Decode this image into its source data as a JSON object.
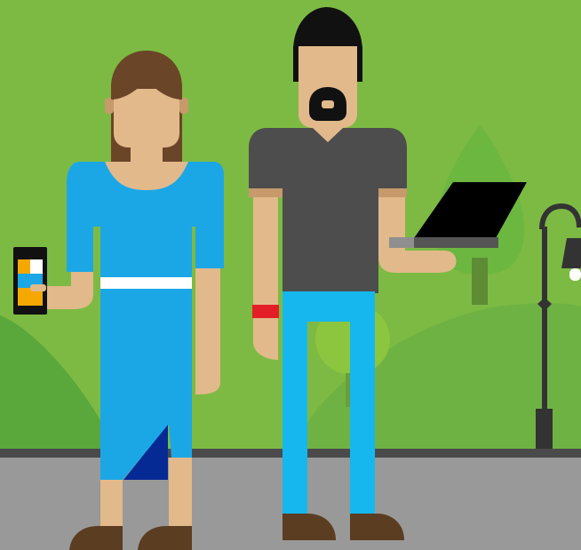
{
  "scene": {
    "colors": {
      "sky": "#7dba43",
      "hill_dark": "#5aa83c",
      "hill_mid": "#6fb244",
      "tree_leaf": "#6cb740",
      "tree_leaf_light": "#8cc63f",
      "tree_trunk": "#5d8c35",
      "ground": "#999999",
      "curb": "#4a4a4a",
      "skin": "#e2b98b",
      "skin_shadow": "#c79a6c",
      "hair_woman": "#6b4528",
      "hair_man": "#111111",
      "dress": "#1ba7e6",
      "dress_dark": "#062a94",
      "belt": "#ffffff",
      "shirt": "#4d4d4d",
      "jeans": "#16b7ef",
      "shoes": "#5b3d22",
      "wristband": "#e41e26",
      "laptop": "#000000",
      "laptop_base": "#8f8f8f",
      "lamp": "#333333"
    },
    "figures": [
      "woman-with-phone",
      "man-with-laptop"
    ],
    "props": [
      "smartphone",
      "laptop",
      "street-lamp",
      "tree",
      "bush"
    ]
  }
}
